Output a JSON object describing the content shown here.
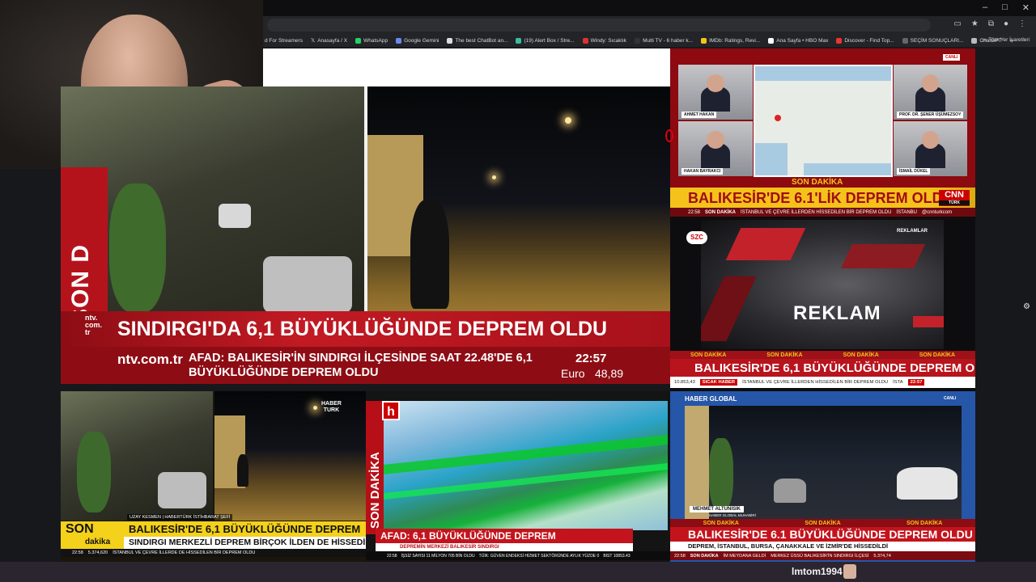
{
  "browser": {
    "window_controls": [
      "–",
      "□",
      "✕"
    ],
    "bookmarks": [
      "d For Streamers",
      "Anasayfa / X",
      "WhatsApp",
      "Google Gemini",
      "The best ChatBot an...",
      "(19) Alert Box / Stre...",
      "Windy: Sıcaklık",
      "Multi TV - 6 haber k...",
      "IMDb: Ratings, Revi...",
      "Ana Sayfa • HBO Max",
      "Discover - Find Top...",
      "SEÇİM SONUÇLARI...",
      "ChatGPT"
    ],
    "bookmarks_overflow": "»",
    "all_bookmarks": "Tüm Yer İşaretleri"
  },
  "ntv": {
    "vertical_label": "SON D",
    "logo": "ntv.\ncom.\ntr",
    "headline": "SINDIRGI'DA 6,1 BÜYÜKLÜĞÜNDE DEPREM OLDU",
    "site": "ntv.com.tr",
    "ticker_text": "AFAD: BALIKESİR'İN SINDIRGI İLÇESİNDE SAAT 22.48'DE 6,1 BÜYÜKLÜĞÜNDE DEPREM OLDU",
    "time": "22:57",
    "euro_label": "Euro",
    "euro_value": "48,89"
  },
  "cnn": {
    "live": "CANLI",
    "panelists": [
      {
        "name": "AHMET HAKAN"
      },
      {
        "name": "PROF. DR. ŞENER ÜŞÜMEZSOY"
      },
      {
        "name": "HAKAN BAYRAKCI"
      },
      {
        "name": "İSMAİL DÜKEL"
      }
    ],
    "son_dakika": "SON DAKİKA",
    "headline": "BALIKESİR'DE 6.1'LİK DEPREM OLDU",
    "logo": "CNN",
    "logo_sub": "TÜRK",
    "ticker": [
      "22:58",
      "SON DAKİKA",
      "İSTANBUL VE ÇEVRE İLLERDEN HİSSEDİLEN BİR DEPREM OLDU",
      "İSTANBU",
      "@cnnturkcom"
    ]
  },
  "szc": {
    "logo": "SZC",
    "reklam_tag": "REKLAMLAR",
    "reklam": "REKLAM",
    "son_dakika": [
      "SON DAKİKA",
      "SON DAKİKA",
      "SON DAKİKA",
      "SON DAKİKA"
    ],
    "headline": "BALIKESİR'DE 6,1 BÜYÜKLÜĞÜNDE DEPREM OLDU",
    "ticker": [
      "10.853,43",
      "SICAK HABER",
      "İSTANBUL VE ÇEVRE İLLERDEN HİSSEDİLEN BİR DEPREM OLDU",
      "İSTA",
      "22:57"
    ]
  },
  "haber_global": {
    "logo": "HABER GLOBAL",
    "live": "CANLI",
    "reporter": "MEHMET ALTUNISIK",
    "role": "HABER GLOBAL MUHABİRİ",
    "son_dakika": [
      "SON DAKİKA",
      "SON DAKİKA",
      "SON DAKİKA"
    ],
    "headline": "BALIKESİR'DE 6.1 BÜYÜKLÜĞÜNDE DEPREM OLDU",
    "subline": "DEPREM, İSTANBUL, BURSA, ÇANAKKALE VE İZMİR'DE HİSSEDİLDİ",
    "ticker": [
      "22:58",
      "SON DAKİKA",
      "İM MEYDANA GELDİ",
      "MERKEZ ÜSSÜ BALIKESİR'İN SINDIRGI İLÇESİ",
      "5.374,74"
    ]
  },
  "haberturk": {
    "logo": "HABER\nTURK",
    "reporter": "UZAY KESMEN | HABERTÜRK İSTİHBARAT ŞEFİ",
    "son": "SON",
    "dakika": "dakika",
    "headline": "BALIKESİR'DE 6,1 BÜYÜKLÜĞÜNDE DEPREM",
    "subline": "SINDIRGI MERKEZLİ DEPREM BİRÇOK İLDEN DE HİSSEDİLDİ",
    "ticker": [
      "22:58",
      "5.374,620",
      "İSTANBUL VE ÇEVRE İLLERDE DE HİSSEDİLEN BİR DEPREM OLDU"
    ]
  },
  "halk": {
    "vertical_label": "SON DAKİKA",
    "logo": "h",
    "headline": "AFAD: 6,1 BÜYÜKLÜĞÜNDE DEPREM",
    "subline": "DEPREMİN MERKEZİ BALIKESİR SINDIRGI",
    "ticker": [
      "22:58",
      "İŞSİZ SAYISI 11 MİLYON 705 BİN OLDU",
      "TÜİK: GÜVEN ENDEKSİ HİZMET SEKTÖRÜNDE AYLIK YÜZDE 0",
      "BIST 10853.43"
    ]
  },
  "chat": {
    "username": "lmtom1994"
  }
}
